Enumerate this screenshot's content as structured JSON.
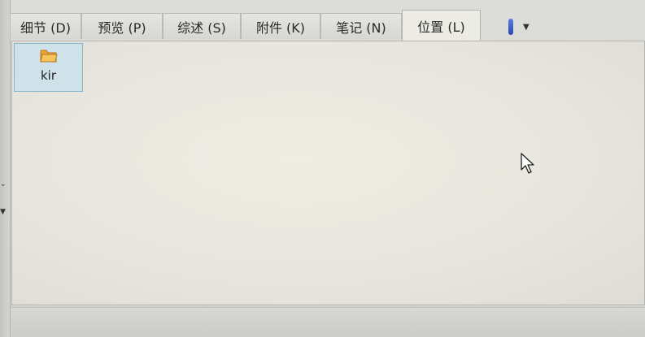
{
  "tabs": [
    {
      "label": "细节 (D)",
      "active": false
    },
    {
      "label": "预览 (P)",
      "active": false
    },
    {
      "label": "综述 (S)",
      "active": false
    },
    {
      "label": "附件 (K)",
      "active": false
    },
    {
      "label": "笔记 (N)",
      "active": false
    },
    {
      "label": "位置 (L)",
      "active": true
    }
  ],
  "tab_extra": {
    "pin_icon": "pin-icon",
    "caret_icon": "caret-down-icon"
  },
  "content": {
    "items": [
      {
        "label": "kir",
        "icon": "folder-icon",
        "selected": true
      }
    ]
  },
  "colors": {
    "selection_fill": "#cfe2ea",
    "selection_border": "#86b4cc",
    "folder": "#e9a43a",
    "pin": "#3a5fd0"
  }
}
